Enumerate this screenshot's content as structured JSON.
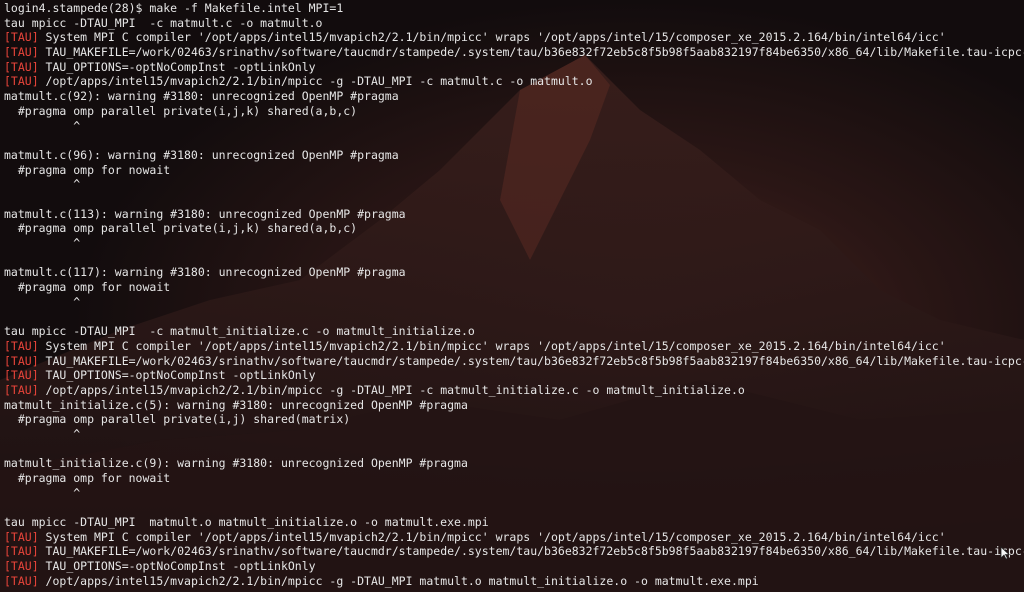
{
  "terminal": {
    "lines": [
      {
        "text": "login4.stampede(28)$ make -f Makefile.intel MPI=1"
      },
      {
        "text": "tau mpicc -DTAU_MPI  -c matmult.c -o matmult.o"
      },
      {
        "tag": "[TAU]",
        "text": " System MPI C compiler '/opt/apps/intel15/mvapich2/2.1/bin/mpicc' wraps '/opt/apps/intel/15/composer_xe_2015.2.164/bin/intel64/icc'"
      },
      {
        "tag": "[TAU]",
        "text": " TAU_MAKEFILE=/work/02463/srinathv/software/taucmdr/stampede/.system/tau/b36e832f72eb5c8f5b98f5aab832197f84be6350/x86_64/lib/Makefile.tau-icpc-mpi"
      },
      {
        "tag": "[TAU]",
        "text": " TAU_OPTIONS=-optNoCompInst -optLinkOnly"
      },
      {
        "tag": "[TAU]",
        "text": " /opt/apps/intel15/mvapich2/2.1/bin/mpicc -g -DTAU_MPI -c matmult.c -o matmult.o"
      },
      {
        "text": "matmult.c(92): warning #3180: unrecognized OpenMP #pragma"
      },
      {
        "text": "  #pragma omp parallel private(i,j,k) shared(a,b,c)"
      },
      {
        "text": "          ^"
      },
      {
        "text": ""
      },
      {
        "text": "matmult.c(96): warning #3180: unrecognized OpenMP #pragma"
      },
      {
        "text": "  #pragma omp for nowait"
      },
      {
        "text": "          ^"
      },
      {
        "text": ""
      },
      {
        "text": "matmult.c(113): warning #3180: unrecognized OpenMP #pragma"
      },
      {
        "text": "  #pragma omp parallel private(i,j,k) shared(a,b,c)"
      },
      {
        "text": "          ^"
      },
      {
        "text": ""
      },
      {
        "text": "matmult.c(117): warning #3180: unrecognized OpenMP #pragma"
      },
      {
        "text": "  #pragma omp for nowait"
      },
      {
        "text": "          ^"
      },
      {
        "text": ""
      },
      {
        "text": "tau mpicc -DTAU_MPI  -c matmult_initialize.c -o matmult_initialize.o"
      },
      {
        "tag": "[TAU]",
        "text": " System MPI C compiler '/opt/apps/intel15/mvapich2/2.1/bin/mpicc' wraps '/opt/apps/intel/15/composer_xe_2015.2.164/bin/intel64/icc'"
      },
      {
        "tag": "[TAU]",
        "text": " TAU_MAKEFILE=/work/02463/srinathv/software/taucmdr/stampede/.system/tau/b36e832f72eb5c8f5b98f5aab832197f84be6350/x86_64/lib/Makefile.tau-icpc-mpi"
      },
      {
        "tag": "[TAU]",
        "text": " TAU_OPTIONS=-optNoCompInst -optLinkOnly"
      },
      {
        "tag": "[TAU]",
        "text": " /opt/apps/intel15/mvapich2/2.1/bin/mpicc -g -DTAU_MPI -c matmult_initialize.c -o matmult_initialize.o"
      },
      {
        "text": "matmult_initialize.c(5): warning #3180: unrecognized OpenMP #pragma"
      },
      {
        "text": "  #pragma omp parallel private(i,j) shared(matrix)"
      },
      {
        "text": "          ^"
      },
      {
        "text": ""
      },
      {
        "text": "matmult_initialize.c(9): warning #3180: unrecognized OpenMP #pragma"
      },
      {
        "text": "  #pragma omp for nowait"
      },
      {
        "text": "          ^"
      },
      {
        "text": ""
      },
      {
        "text": "tau mpicc -DTAU_MPI  matmult.o matmult_initialize.o -o matmult.exe.mpi"
      },
      {
        "tag": "[TAU]",
        "text": " System MPI C compiler '/opt/apps/intel15/mvapich2/2.1/bin/mpicc' wraps '/opt/apps/intel/15/composer_xe_2015.2.164/bin/intel64/icc'"
      },
      {
        "tag": "[TAU]",
        "text": " TAU_MAKEFILE=/work/02463/srinathv/software/taucmdr/stampede/.system/tau/b36e832f72eb5c8f5b98f5aab832197f84be6350/x86_64/lib/Makefile.tau-icpc-mpi"
      },
      {
        "tag": "[TAU]",
        "text": " TAU_OPTIONS=-optNoCompInst -optLinkOnly"
      },
      {
        "tag": "[TAU]",
        "text": " /opt/apps/intel15/mvapich2/2.1/bin/mpicc -g -DTAU_MPI matmult.o matmult_initialize.o -o matmult.exe.mpi"
      }
    ]
  },
  "colors": {
    "text": "#e6e6e6",
    "tag": "#e8443a",
    "background": "#120c0d"
  },
  "icons": {
    "cursor": "mouse-pointer-icon"
  }
}
